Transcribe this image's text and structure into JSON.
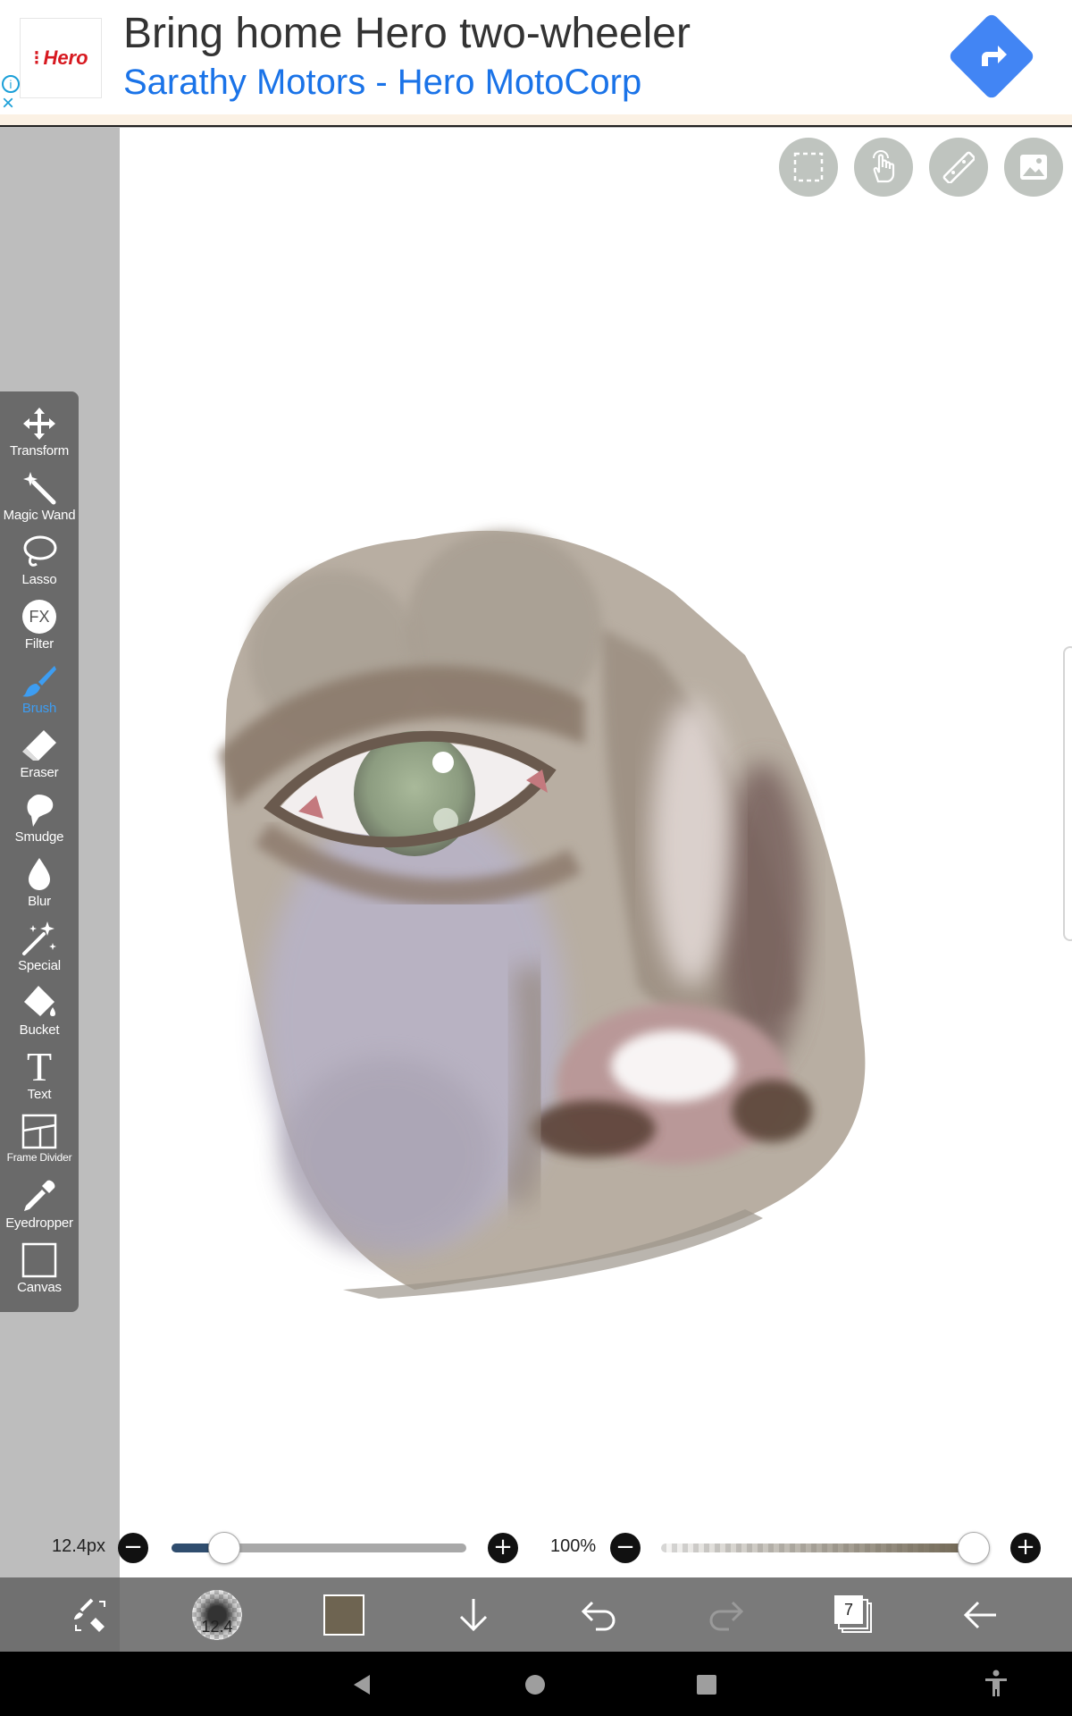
{
  "ad": {
    "brand": "Hero",
    "title": "Bring home Hero two-wheeler",
    "subtitle": "Sarathy Motors - Hero MotoCorp",
    "info_glyph": "i",
    "close_glyph": "×",
    "accent": "#1a73e8",
    "direction_color": "#4285f4"
  },
  "tools": [
    {
      "id": "transform",
      "label": "Transform",
      "icon": "move-arrows-icon"
    },
    {
      "id": "magic-wand",
      "label": "Magic Wand",
      "icon": "magic-wand-icon"
    },
    {
      "id": "lasso",
      "label": "Lasso",
      "icon": "lasso-icon"
    },
    {
      "id": "filter",
      "label": "Filter",
      "icon": "fx-icon",
      "glyph": "FX"
    },
    {
      "id": "brush",
      "label": "Brush",
      "icon": "brush-icon",
      "active": true
    },
    {
      "id": "eraser",
      "label": "Eraser",
      "icon": "eraser-icon"
    },
    {
      "id": "smudge",
      "label": "Smudge",
      "icon": "smudge-icon"
    },
    {
      "id": "blur",
      "label": "Blur",
      "icon": "blur-drop-icon"
    },
    {
      "id": "special",
      "label": "Special",
      "icon": "special-sparkle-icon"
    },
    {
      "id": "bucket",
      "label": "Bucket",
      "icon": "bucket-icon"
    },
    {
      "id": "text",
      "label": "Text",
      "icon": "text-icon",
      "glyph": "T"
    },
    {
      "id": "frame-divider",
      "label": "Frame Divider",
      "icon": "frame-divider-icon"
    },
    {
      "id": "eyedropper",
      "label": "Eyedropper",
      "icon": "eyedropper-icon"
    },
    {
      "id": "canvas",
      "label": "Canvas",
      "icon": "canvas-icon"
    }
  ],
  "top_tools": [
    "selection-icon",
    "hand-touch-icon",
    "ruler-icon",
    "image-icon"
  ],
  "brush": {
    "size_label": "12.4px",
    "size_slider_fraction": 0.18,
    "opacity_label": "100%",
    "opacity_slider_fraction": 1.0,
    "minus_glyph": "−",
    "plus_glyph": "+"
  },
  "bottom_bar": {
    "brush_size_badge": "12.4",
    "layer_count": "7",
    "color_swatch": "#6e6451",
    "active_tool_color": "#3d9df2"
  }
}
